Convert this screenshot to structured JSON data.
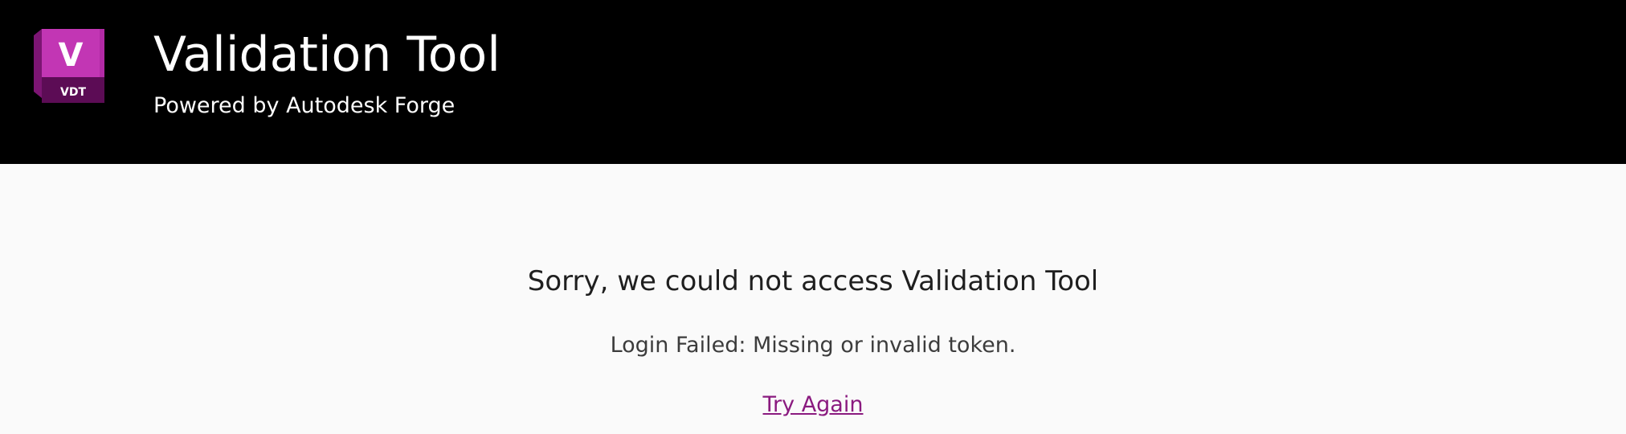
{
  "header": {
    "logo": {
      "icon": "vdt-app-icon",
      "letter": "V",
      "badge": "VDT",
      "color_primary": "#a3229a",
      "color_dark": "#6a0f62"
    },
    "title": "Validation Tool",
    "subtitle": "Powered by Autodesk Forge"
  },
  "main": {
    "error_title": "Sorry, we could not access Validation Tool",
    "error_message": "Login Failed: Missing or invalid token.",
    "retry_label": "Try Again",
    "link_color": "#8a1a7f"
  }
}
